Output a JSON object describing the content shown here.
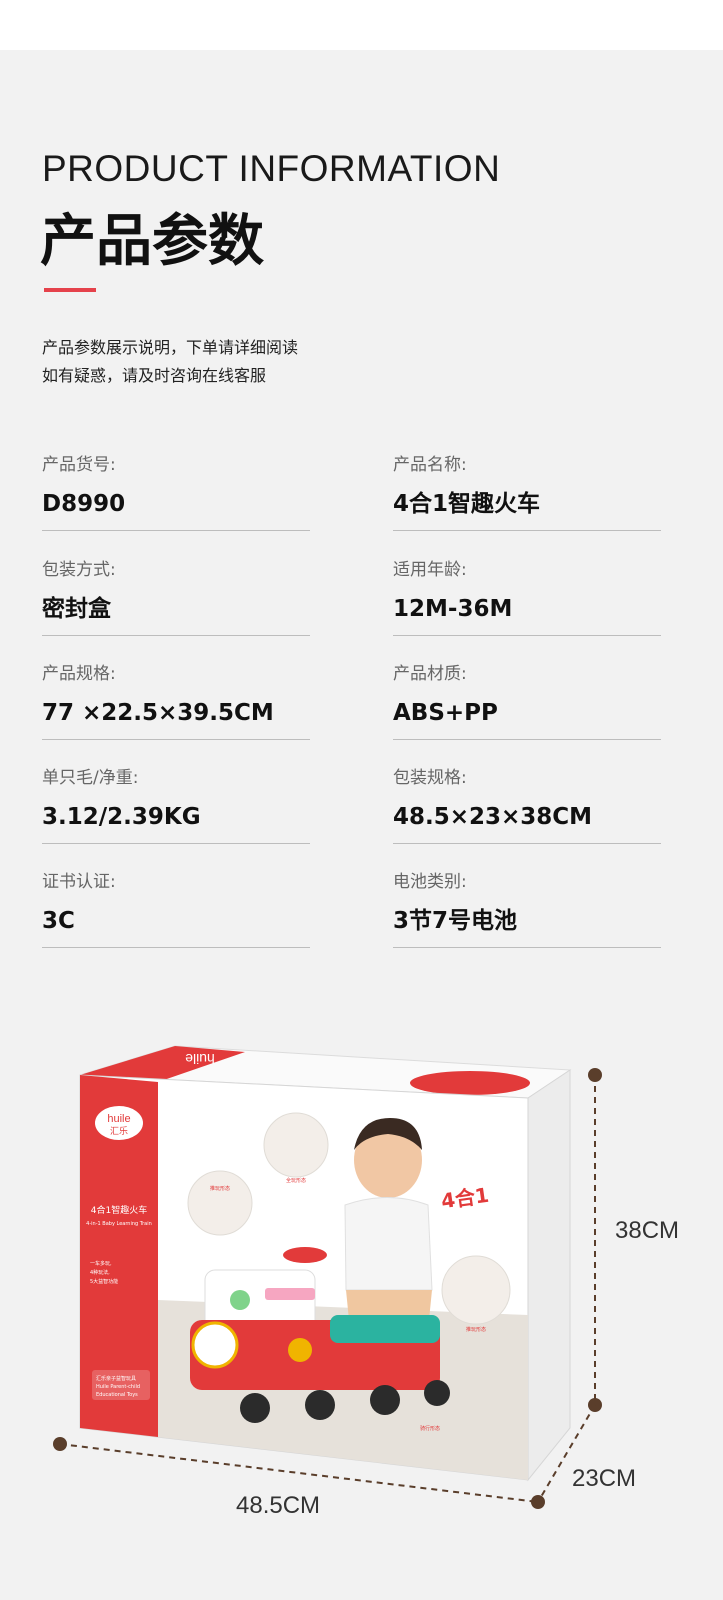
{
  "header": {
    "title_en": "PRODUCT INFORMATION",
    "title_cn": "产品参数",
    "note_line1": "产品参数展示说明，下单请详细阅读",
    "note_line2": "如有疑惑，请及时咨询在线客服"
  },
  "specs": [
    {
      "label": "产品货号:",
      "value": "D8990"
    },
    {
      "label": "产品名称:",
      "value": "4合1智趣火车"
    },
    {
      "label": "包装方式:",
      "value": "密封盒"
    },
    {
      "label": "适用年龄:",
      "value": "12M-36M"
    },
    {
      "label": "产品规格:",
      "value": "77 ×22.5×39.5CM"
    },
    {
      "label": "产品材质:",
      "value": "ABS+PP"
    },
    {
      "label": "单只毛/净重:",
      "value": "3.12/2.39KG"
    },
    {
      "label": "包装规格:",
      "value": "48.5×23×38CM"
    },
    {
      "label": "证书认证:",
      "value": "3C"
    },
    {
      "label": "电池类别:",
      "value": "3节7号电池"
    }
  ],
  "box": {
    "brand_en": "huile",
    "brand_cn": "汇乐",
    "top_brand": "huile",
    "product_cn": "4合1智趣火车",
    "product_en": "4-in-1 Baby Learning Train",
    "badge": "4合1",
    "mode_labels": [
      "全玩形态",
      "推玩形态",
      "推玩形态",
      "骑行形态"
    ],
    "side_tag_line1": "汇乐亲子益智玩具",
    "side_tag_line2": "Huile Parent-child",
    "side_tag_line3": "Educational Toys",
    "feature_lines": [
      "一车多玩,",
      "4种玩法,",
      "5大益智功能"
    ]
  },
  "dimensions": {
    "height": "38CM",
    "depth": "23CM",
    "width": "48.5CM"
  },
  "colors": {
    "accent": "#e5424b",
    "brand_red": "#e23a3a"
  }
}
